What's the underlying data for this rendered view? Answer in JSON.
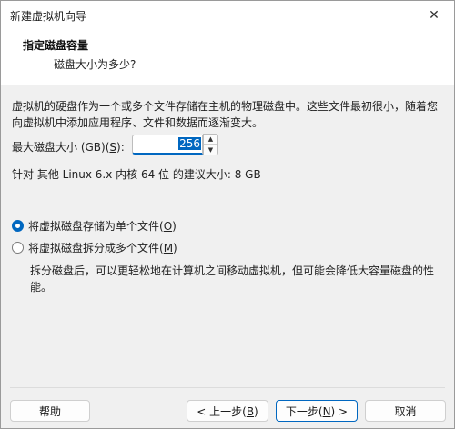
{
  "window": {
    "title": "新建虚拟机向导"
  },
  "header": {
    "title": "指定磁盘容量",
    "subtitle": "磁盘大小为多少?"
  },
  "description": "虚拟机的硬盘作为一个或多个文件存储在主机的物理磁盘中。这些文件最初很小，随着您向虚拟机中添加应用程序、文件和数据而逐渐变大。",
  "disk_size": {
    "label_prefix": "最大磁盘大小 (GB)(",
    "label_key": "S",
    "label_suffix": "):",
    "value": "256"
  },
  "recommendation": "针对 其他 Linux 6.x 内核 64 位 的建议大小: 8 GB",
  "options": [
    {
      "label_prefix": "将虚拟磁盘存储为单个文件(",
      "key": "O",
      "label_suffix": ")",
      "checked": true
    },
    {
      "label_prefix": "将虚拟磁盘拆分成多个文件(",
      "key": "M",
      "label_suffix": ")",
      "checked": false
    }
  ],
  "split_note": "拆分磁盘后，可以更轻松地在计算机之间移动虚拟机，但可能会降低大容量磁盘的性能。",
  "buttons": {
    "help": "帮助",
    "back_prefix": "< 上一步(",
    "back_key": "B",
    "back_suffix": ")",
    "next_prefix": "下一步(",
    "next_key": "N",
    "next_suffix": ") >",
    "cancel": "取消"
  },
  "colors": {
    "accent": "#0067c0",
    "background": "#f0f0f0",
    "header_bg": "#ffffff"
  }
}
